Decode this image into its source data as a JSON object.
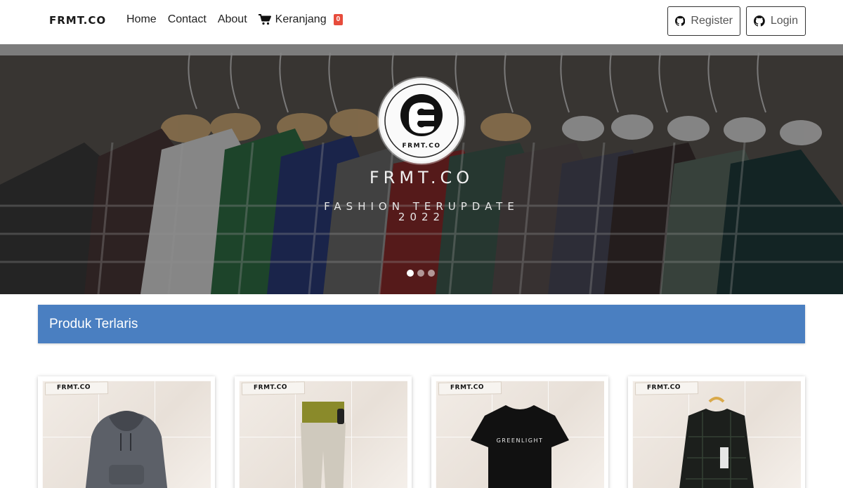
{
  "navbar": {
    "brand": "FRMT.CO",
    "links": [
      {
        "label": "Home"
      },
      {
        "label": "Contact"
      },
      {
        "label": "About"
      }
    ],
    "cart": {
      "label": "Keranjang",
      "count": "0",
      "icon": "cart-icon"
    },
    "auth": {
      "register": {
        "label": "Register",
        "icon": "github-icon"
      },
      "login": {
        "label": "Login",
        "icon": "github-icon"
      }
    }
  },
  "hero": {
    "logo_text": "FRMT.CO",
    "title": "FRMT.CO",
    "subtitle_line1": "FASHION TERUPDATE",
    "subtitle_line2": "2022",
    "slides": 3,
    "active_slide": 1
  },
  "section": {
    "title": "Produk Terlaris"
  },
  "products": [
    {
      "tag": "FRMT.CO",
      "item": "hoodie"
    },
    {
      "tag": "FRMT.CO",
      "item": "chino-pants"
    },
    {
      "tag": "FRMT.CO",
      "item": "t-shirt",
      "print": "GREENLIGHT"
    },
    {
      "tag": "FRMT.CO",
      "item": "flannel-shirt"
    }
  ],
  "colors": {
    "section_bar": "#4a7fc1",
    "badge": "#e74c3c"
  }
}
